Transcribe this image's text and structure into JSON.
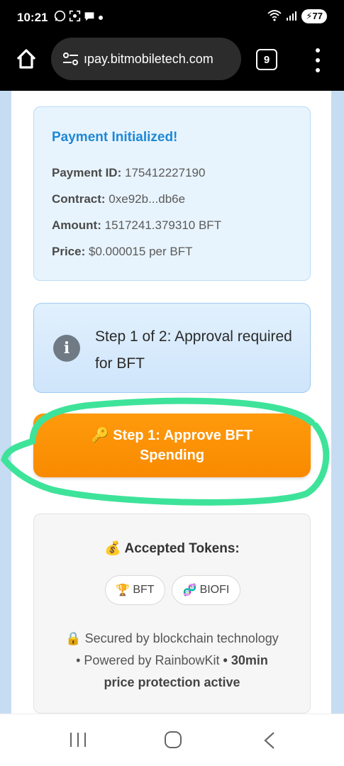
{
  "status_bar": {
    "time": "10:21",
    "battery": "77",
    "left_icons": [
      "whatsapp-icon",
      "scan-icon",
      "chat-icon",
      "dot-icon"
    ],
    "right_icons": [
      "wifi-icon",
      "signal-icon",
      "battery-icon"
    ]
  },
  "browser": {
    "url": "ıpay.bitmobiletech.com",
    "tab_count": "9"
  },
  "payment": {
    "title": "Payment Initialized!",
    "id_label": "Payment ID:",
    "id_value": "175412227190",
    "contract_label": "Contract:",
    "contract_value": "0xe92b...db6e",
    "amount_label": "Amount:",
    "amount_value": "1517241.379310 BFT",
    "price_label": "Price:",
    "price_value": "$0.000015 per BFT"
  },
  "step_notice": {
    "text": "Step 1 of 2: Approval required for BFT",
    "icon": "info-icon"
  },
  "approve_button": {
    "emoji": "🔑",
    "label": "Step 1: Approve BFT Spending"
  },
  "tokens": {
    "emoji": "💰",
    "title": "Accepted Tokens:",
    "items": [
      {
        "emoji": "🏆",
        "label": "BFT"
      },
      {
        "emoji": "🧬",
        "label": "BIOFI"
      }
    ],
    "secured_emoji": "🔒",
    "secured_text": "Secured by blockchain technology",
    "powered_text": "• Powered by RainbowKit",
    "protection_text": "• 30min price protection active"
  },
  "colors": {
    "accent_blue": "#1e88d6",
    "button_orange": "#f88a00",
    "annotation_green": "#3ee39a"
  }
}
